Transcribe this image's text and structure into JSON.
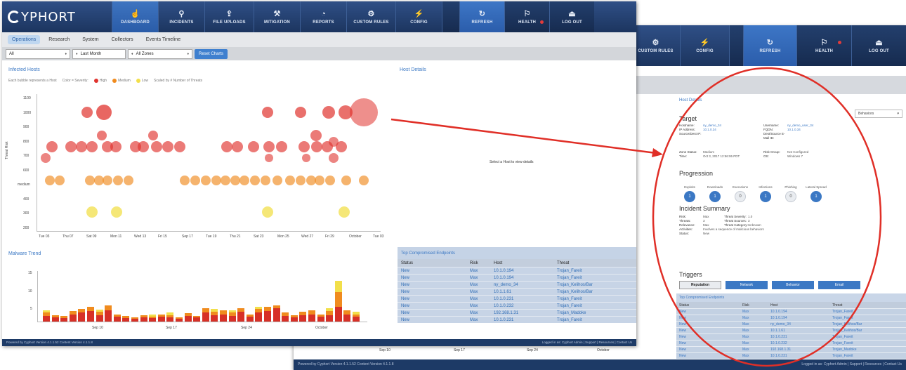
{
  "front": {
    "logo": "YPHORT",
    "nav": [
      {
        "label": "DASHBOARD",
        "icon": "☝",
        "active": true
      },
      {
        "label": "INCIDENTS",
        "icon": "⚲"
      },
      {
        "label": "FILE UPLOADS",
        "icon": "⇪"
      },
      {
        "label": "MITIGATION",
        "icon": "⚒"
      },
      {
        "label": "REPORTS",
        "icon": "◔"
      },
      {
        "label": "CUSTOM RULES",
        "icon": "⚙"
      },
      {
        "label": "CONFIG",
        "icon": "⚡"
      },
      {
        "label": "REFRESH",
        "icon": "↻"
      },
      {
        "label": "HEALTH",
        "icon": "⚐"
      },
      {
        "label": "LOG OUT",
        "icon": "⏏"
      }
    ],
    "tabs": [
      "Operations",
      "Research",
      "System",
      "Collectors",
      "Events Timeline"
    ],
    "filters": {
      "zone_scope": "All",
      "period": "Last Month",
      "zones": "All Zones",
      "reset": "Reset Charts"
    },
    "infected_hosts": {
      "title": "Infected Hosts",
      "legend_prefix": "Each bubble represents a Host",
      "legend_color_label": "Color = Severity:",
      "legend_high": "High",
      "legend_medium": "Medium",
      "legend_low": "Low",
      "legend_size": "Scaled by # Number of Threats",
      "y_title": "Threat Risk",
      "y_ticks": [
        "1100",
        "1000",
        "900",
        "800",
        "700",
        "600",
        "medium",
        "400",
        "300",
        "200"
      ],
      "x_ticks": [
        "Tue 03",
        "Thu 07",
        "Sat 09",
        "Mon 11",
        "Wed 13",
        "Fri 15",
        "Sep 17",
        "Tue 19",
        "Thu 21",
        "Sat 23",
        "Mon 25",
        "Wed 27",
        "Fri 29",
        "October",
        "Tue 03"
      ]
    },
    "host_details": {
      "title": "Host Details",
      "placeholder": "Select a Host to view details"
    },
    "malware_trend": {
      "title": "Malware Trend",
      "y_ticks": [
        "15",
        "10",
        "5"
      ],
      "x_ticks": [
        "Sep 10",
        "Sep 17",
        "Sep 24",
        "October"
      ]
    },
    "top_endpoints": {
      "title": "Top Compromised Endpoints",
      "columns": [
        "Status",
        "Risk",
        "Host",
        "Threat"
      ],
      "rows": [
        [
          "New",
          "Max",
          "10.1.0.194",
          "Trojan_Fareit"
        ],
        [
          "New",
          "Max",
          "10.1.0.194",
          "Trojan_Fareit"
        ],
        [
          "New",
          "Max",
          "ny_demo_34",
          "Trojan_Kelihos/Bar"
        ],
        [
          "New",
          "Max",
          "10.1.1.61",
          "Trojan_Kelihos/Bar"
        ],
        [
          "New",
          "Max",
          "10.1.0.231",
          "Trojan_Fareit"
        ],
        [
          "New",
          "Max",
          "10.1.0.232",
          "Trojan_Fareit"
        ],
        [
          "New",
          "Max",
          "192.168.1.31",
          "Trojan_Madoke"
        ],
        [
          "New",
          "Max",
          "10.1.0.231",
          "Trojan_Fareit"
        ]
      ]
    },
    "footer_left": "Powered by Cyphort Version 4.1.1.52 Content Version 4.1.1.8",
    "footer_right": "Logged in as: Cyphort Admin  |  Support  |  Resources  |  Contact Us"
  },
  "back": {
    "nav": [
      {
        "label": "CUSTOM RULES",
        "icon": "⚙"
      },
      {
        "label": "CONFIG",
        "icon": "⚡"
      },
      {
        "label": "REFRESH",
        "icon": "↻"
      },
      {
        "label": "HEALTH",
        "icon": "⚐"
      },
      {
        "label": "LOG OUT",
        "icon": "⏏"
      }
    ],
    "host_details_title": "Host Details",
    "select_value": "Behaviors",
    "target_heading": "Target",
    "target_fields": [
      [
        "Hostname:",
        "ny_demo_34"
      ],
      [
        "IP Address:",
        "10.1.0.34"
      ],
      [
        "Source/Dest IP:",
        ""
      ],
      [
        "Username:",
        "ny_demo_user_34"
      ],
      [
        "FQDN:",
        "10.1.0.34"
      ],
      [
        "Dest/Source E-Mail ID:",
        ""
      ]
    ],
    "zone_fields": [
      [
        "Zone Status:",
        "Medium"
      ],
      [
        "Time:",
        "Oct 3, 2017 12:56:06 PDT"
      ],
      [
        "Risk Group:",
        "Not Configured"
      ],
      [
        "OS:",
        "Windows 7"
      ]
    ],
    "progression_heading": "Progression",
    "progression_steps": [
      "Exploits",
      "Downloads",
      "Executions",
      "Infections",
      "Phishing",
      "Lateral Spread"
    ],
    "progression_values": [
      "1",
      "1",
      "0",
      "1",
      "0",
      "1"
    ],
    "incident_heading": "Incident Summary",
    "incident_fields": [
      [
        "Risk:",
        "Max",
        "Threat Severity:",
        "1.0"
      ],
      [
        "Threats:",
        "3",
        "Threat Sources:",
        "3"
      ],
      [
        "Relevance:",
        "Max",
        "Threat Category:",
        "Unknown"
      ],
      [
        "Activities:",
        "Involves a sequence of malicious behaviors",
        "",
        ""
      ],
      [
        "Status:",
        "New",
        "",
        ""
      ]
    ],
    "triggers_heading": "Triggers",
    "triggers": [
      "Reputation",
      "Network",
      "Behavior",
      "Email"
    ],
    "top_endpoints": {
      "title": "Top Compromised Endpoints",
      "columns": [
        "Status",
        "Risk",
        "Host",
        "Threat"
      ],
      "rows": [
        [
          "New",
          "Max",
          "10.1.0.194",
          "Trojan_Fareit"
        ],
        [
          "New",
          "Max",
          "10.1.0.194",
          "Trojan_Fareit"
        ],
        [
          "New",
          "Max",
          "ny_demo_34",
          "Trojan_Kelihos/Bar"
        ],
        [
          "New",
          "Max",
          "10.1.1.61",
          "Trojan_Kelihos/Bar"
        ],
        [
          "New",
          "Max",
          "10.1.0.231",
          "Trojan_Fareit"
        ],
        [
          "New",
          "Max",
          "10.1.0.232",
          "Trojan_Fareit"
        ],
        [
          "New",
          "Max",
          "192.168.1.31",
          "Trojan_Madoke"
        ],
        [
          "New",
          "Max",
          "10.1.0.231",
          "Trojan_Fareit"
        ]
      ]
    },
    "axis_ticks": [
      "Sep 10",
      "Sep 17",
      "Sep 24",
      "October"
    ],
    "footer_left": "Powered by Cyphort Version 4.1.1.52 Content Version 4.1.1.8",
    "footer_right": "Logged in as: Cyphort Admin  |  Support  |  Resources  |  Contact Us"
  },
  "colors": {
    "navy": "#1c355f",
    "active": "#3e74c0",
    "high": "#e0332e",
    "medium": "#f08b1e",
    "low": "#f2df4a",
    "link": "#3b78c4",
    "annotation": "#e02f27"
  }
}
